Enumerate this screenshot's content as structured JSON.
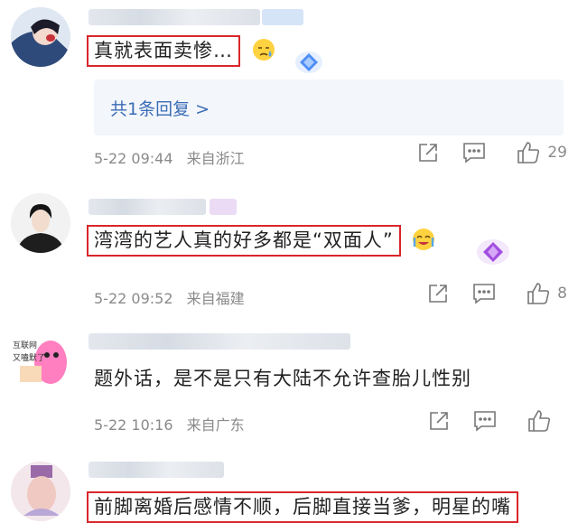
{
  "comments": [
    {
      "text": "真就表面卖惨…",
      "reply_summary": "共1条回复 >",
      "time": "5-22 09:44",
      "location": "来自浙江",
      "likes": "29"
    },
    {
      "text": "湾湾的艺人真的好多都是“双面人”",
      "time": "5-22 09:52",
      "location": "来自福建",
      "likes": "8"
    },
    {
      "text": "题外话，是不是只有大陆不允许查胎儿性别",
      "avatar_text": [
        "互联网",
        "又嗑默了"
      ],
      "time": "5-22 10:16",
      "location": "来自广东"
    },
    {
      "text": "前脚离婚后感情不顺，后脚直接当爹，明星的嘴"
    }
  ],
  "colors": {
    "highlight_border": "#d9262b",
    "link": "#3b6db5",
    "meta": "#8a8a8a",
    "reply_bg": "#f3f6fb"
  },
  "icons": [
    "share-icon",
    "comment-icon",
    "like-icon",
    "diamond-badge-icon",
    "emoji-icon"
  ]
}
